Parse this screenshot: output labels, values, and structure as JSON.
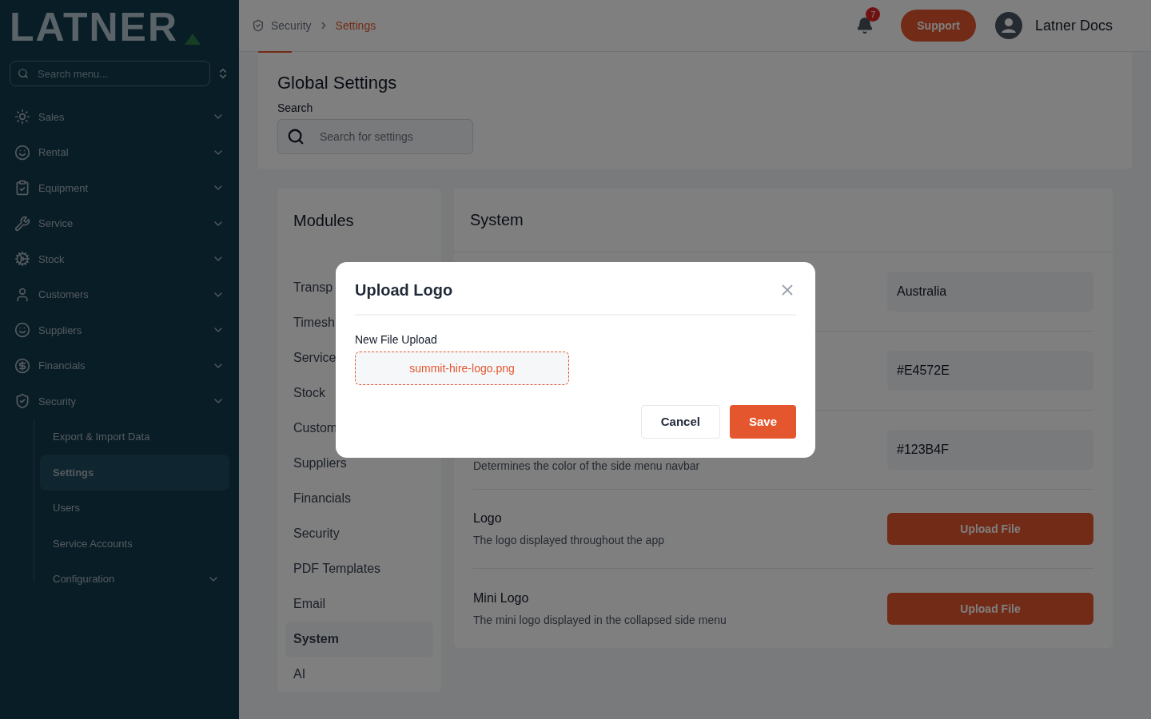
{
  "sidebar": {
    "logo": "LATNER",
    "search": {
      "placeholder": "Search menu..."
    },
    "items": [
      {
        "label": "Sales"
      },
      {
        "label": "Rental"
      },
      {
        "label": "Equipment"
      },
      {
        "label": "Service"
      },
      {
        "label": "Stock"
      },
      {
        "label": "Customers"
      },
      {
        "label": "Suppliers"
      },
      {
        "label": "Financials"
      },
      {
        "label": "Security",
        "children": [
          {
            "label": "Export & Import Data",
            "selected": false,
            "expandable": false
          },
          {
            "label": "Settings",
            "selected": true,
            "expandable": false
          },
          {
            "label": "Users",
            "selected": false,
            "expandable": false
          },
          {
            "label": "Service Accounts",
            "selected": false,
            "expandable": false
          },
          {
            "label": "Configuration",
            "selected": false,
            "expandable": true
          }
        ]
      }
    ]
  },
  "header": {
    "breadcrumb": [
      {
        "label": "Security",
        "selected": false
      },
      {
        "label": "Settings",
        "selected": true
      }
    ],
    "notifications": "7",
    "support": "Support",
    "user": "Latner Docs"
  },
  "global": {
    "title": "Global Settings",
    "search_label": "Search",
    "search": {
      "placeholder": "Search for settings"
    }
  },
  "modules": {
    "title": "Modules",
    "items": [
      {
        "label": "Transp",
        "selected": false
      },
      {
        "label": "Timesh",
        "selected": false
      },
      {
        "label": "Service",
        "selected": false
      },
      {
        "label": "Stock",
        "selected": false
      },
      {
        "label": "Custom",
        "selected": false
      },
      {
        "label": "Suppliers",
        "selected": false
      },
      {
        "label": "Financials",
        "selected": false
      },
      {
        "label": "Security",
        "selected": false
      },
      {
        "label": "PDF Templates",
        "selected": false
      },
      {
        "label": "Email",
        "selected": false
      },
      {
        "label": "System",
        "selected": true
      },
      {
        "label": "AI",
        "selected": false
      }
    ]
  },
  "system": {
    "title": "System",
    "rows": [
      {
        "kind": "value",
        "value": "Australia"
      },
      {
        "kind": "value",
        "value": "#E4572E"
      },
      {
        "kind": "value",
        "description": "Determines the color of the side menu navbar",
        "value": "#123B4F"
      },
      {
        "kind": "upload",
        "label": "Logo",
        "description": "The logo displayed throughout the app",
        "button": "Upload File"
      },
      {
        "kind": "upload",
        "label": "Mini Logo",
        "description": "The mini logo displayed in the collapsed side menu",
        "button": "Upload File"
      }
    ]
  },
  "dialog": {
    "title": "Upload Logo",
    "field_label": "New File Upload",
    "file": "summit-hire-logo.png",
    "buttons": [
      {
        "label": "Cancel",
        "kind": "secondary"
      },
      {
        "label": "Save",
        "kind": "primary"
      }
    ]
  }
}
